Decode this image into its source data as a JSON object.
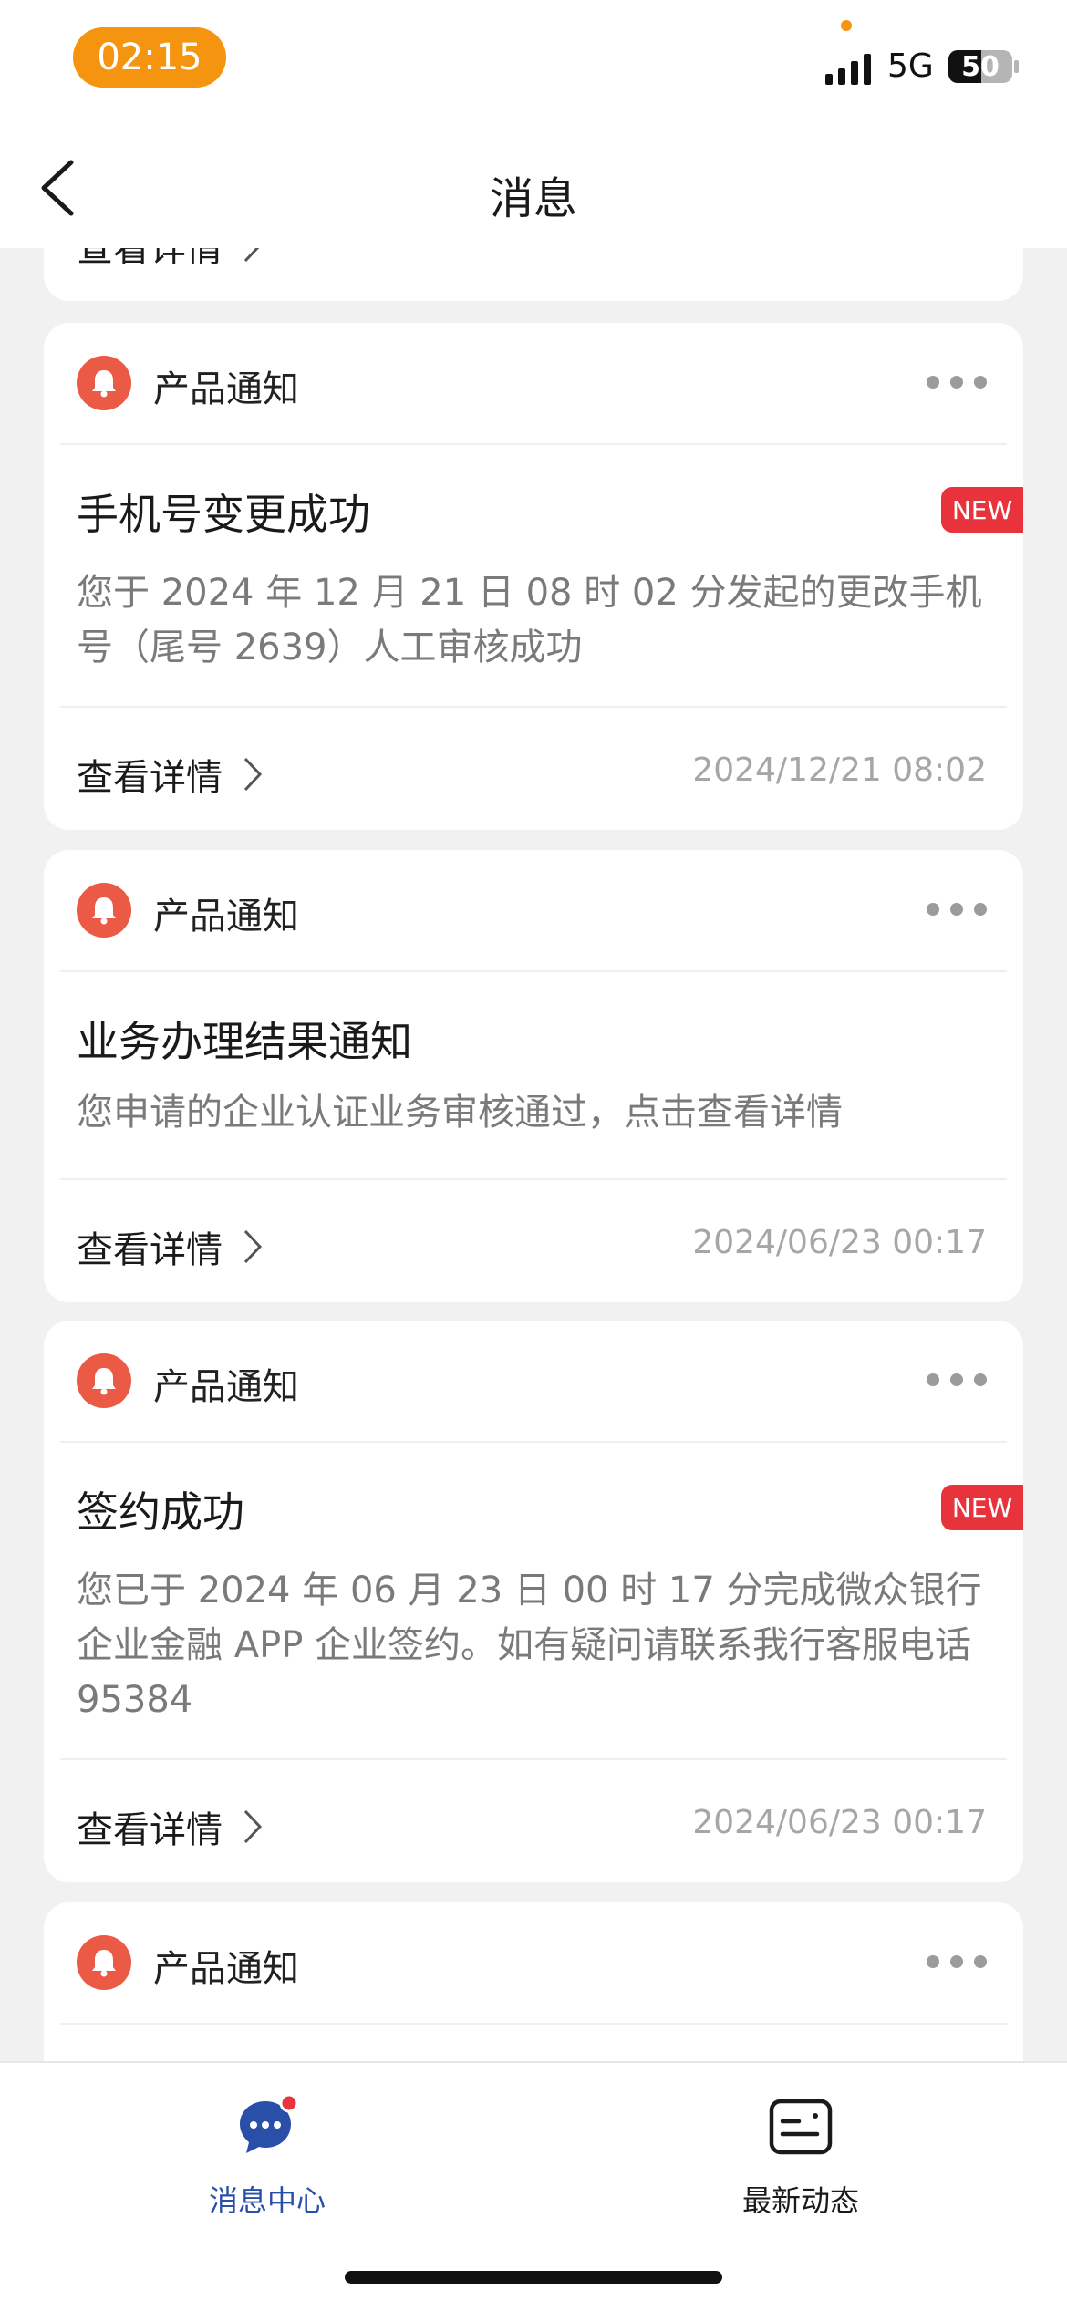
{
  "status_bar": {
    "time": "02:15",
    "network": "5G",
    "battery": "50"
  },
  "nav": {
    "title": "消息"
  },
  "peek_card": {
    "link": "查看详情"
  },
  "cards": [
    {
      "category": "产品通知",
      "title": "手机号变更成功",
      "badge": "NEW",
      "body": "您于 2024 年 12 月 21 日 08 时 02 分发起的更改手机号（尾号 2639）人工审核成功",
      "link": "查看详情",
      "date": "2024/12/21 08:02"
    },
    {
      "category": "产品通知",
      "title": "业务办理结果通知",
      "body": "您申请的企业认证业务审核通过，点击查看详情",
      "link": "查看详情",
      "date": "2024/06/23 00:17"
    },
    {
      "category": "产品通知",
      "title": "签约成功",
      "badge": "NEW",
      "body": "您已于 2024 年 06 月 23 日 00 时 17 分完成微众银行企业金融 APP 企业签约。如有疑问请联系我行客服电话 95384",
      "link": "查看详情",
      "date": "2024/06/23 00:17"
    },
    {
      "category": "产品通知"
    }
  ],
  "tabs": [
    {
      "label": "消息中心",
      "icon": "chat-bubble-icon",
      "active": true,
      "color": "#2a4fa8"
    },
    {
      "label": "最新动态",
      "icon": "news-card-icon",
      "active": false,
      "color": "#1a1a1a"
    }
  ],
  "colors": {
    "accent_orange": "#f5940f",
    "bell_red": "#eb5a44",
    "badge_red": "#e8323c",
    "tab_blue": "#2a4fa8"
  }
}
